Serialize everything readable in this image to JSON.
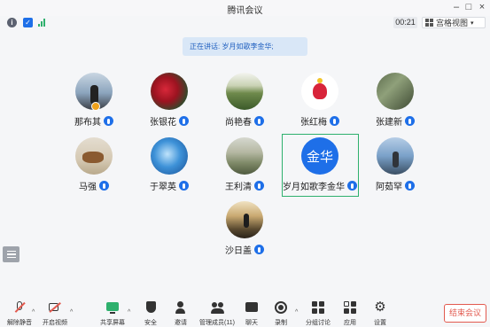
{
  "window": {
    "title": "腾讯会议"
  },
  "status": {
    "timer": "00:21",
    "view_label": "宫格视图"
  },
  "banner": {
    "text": "正在讲话: 岁月如歌李金华;"
  },
  "participants": [
    {
      "name": "那布其"
    },
    {
      "name": "张银花"
    },
    {
      "name": "尚艳春"
    },
    {
      "name": "张红梅"
    },
    {
      "name": "张建新"
    },
    {
      "name": "马强"
    },
    {
      "name": "于翠英"
    },
    {
      "name": "王利清"
    },
    {
      "name": "岁月如歌李金华",
      "avatar_text": "金华"
    },
    {
      "name": "阿茹罕"
    },
    {
      "name": "沙日盖"
    }
  ],
  "toolbar": {
    "unmute": "解除静音",
    "video": "开启视频",
    "share": "共享屏幕",
    "security": "安全",
    "invite": "邀请",
    "members": "管理成员(11)",
    "chat": "聊天",
    "record": "录制",
    "breakout": "分组讨论",
    "apps": "应用",
    "settings": "设置",
    "end": "结束会议"
  },
  "colors": {
    "accent": "#1e6fe8",
    "end_red": "#e25a4f",
    "selected_green": "#2eb06d"
  }
}
